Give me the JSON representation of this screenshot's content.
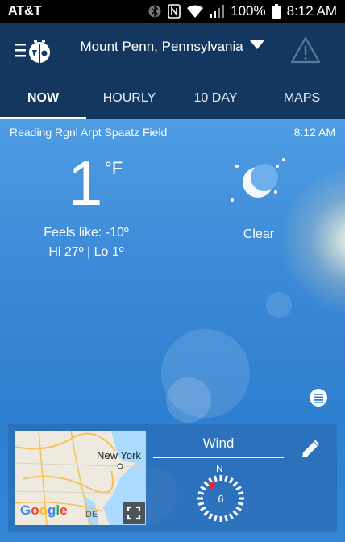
{
  "status_bar": {
    "carrier": "AT&T",
    "battery": "100%",
    "time": "8:12 AM"
  },
  "header": {
    "location": "Mount Penn, Pennsylvania"
  },
  "tabs": [
    {
      "label": "NOW",
      "active": true
    },
    {
      "label": "HOURLY",
      "active": false
    },
    {
      "label": "10 DAY",
      "active": false
    },
    {
      "label": "MAPS",
      "active": false
    }
  ],
  "current": {
    "station": "Reading Rgnl Arpt Spaatz Field",
    "observed_time": "8:12 AM",
    "temperature": "1",
    "unit": "°F",
    "feels_like": "Feels like: -10º",
    "hi_lo": "Hi 27º | Lo 1º",
    "condition": "Clear",
    "icon": "moon-icon"
  },
  "map": {
    "city_label": "New York",
    "state_label": "DE",
    "logo": "Google"
  },
  "wind": {
    "title": "Wind",
    "direction_label": "N",
    "speed": "6"
  },
  "colors": {
    "header_bg": "#13375e",
    "sky_top": "#4e9ce3",
    "sky_bottom": "#3485d4",
    "wind_arrow": "#e8282b"
  }
}
